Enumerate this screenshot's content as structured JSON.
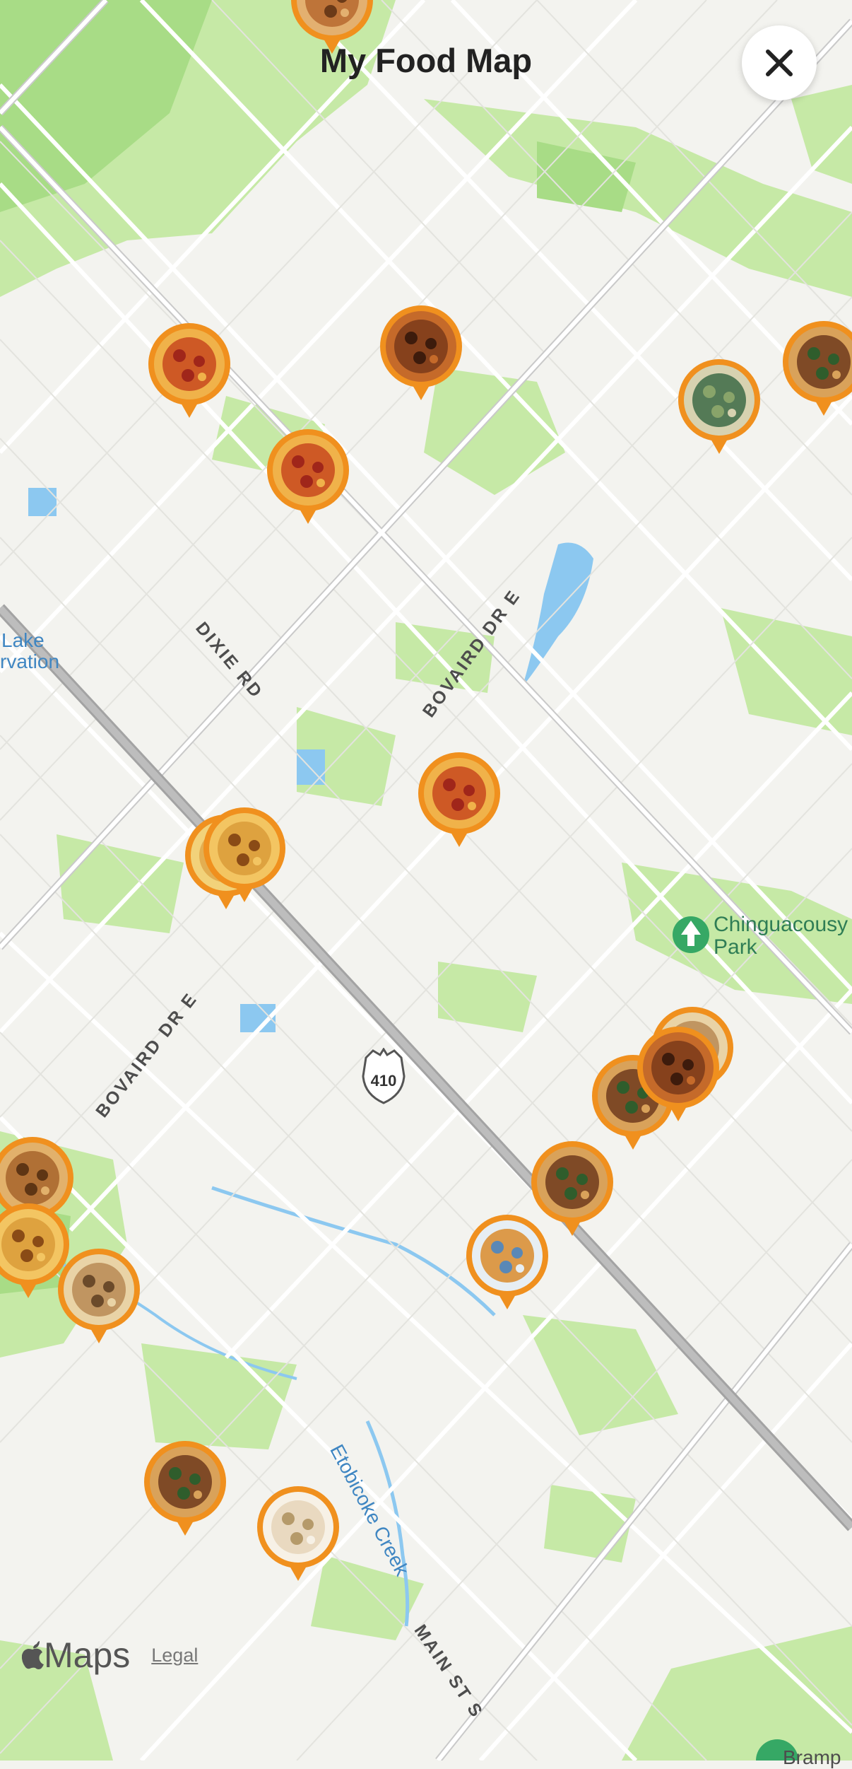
{
  "header": {
    "title": "My Food Map",
    "close_icon": "close-icon"
  },
  "map": {
    "road_labels": [
      "DIXIE RD",
      "BOVAIRD DR E",
      "BOVAIRD DR E",
      "MAIN ST S"
    ],
    "water_labels": [
      "Etobicoke Creek"
    ],
    "places": {
      "lake_fragment_1": "Lake",
      "lake_fragment_2": "rvation",
      "park": "Chinguacousy Park",
      "park_l1": "Chinguacousy",
      "park_l2": "Park",
      "bottom_fragment": "Bramp"
    },
    "highway_shield": "410",
    "colors": {
      "background": "#f3f3ef",
      "green": "#c6e9a6",
      "dark_green": "#a8dc86",
      "water": "#8cc8f0",
      "road": "#ffffff",
      "highway": "#a3a3a3",
      "pin_orange": "#f0901e"
    }
  },
  "food_pins": [
    {
      "food": "pizza"
    },
    {
      "food": "pizza"
    },
    {
      "food": "wings"
    },
    {
      "food": "salad"
    },
    {
      "food": "burger"
    },
    {
      "food": "pizza"
    },
    {
      "food": "nachos"
    },
    {
      "food": "fries"
    },
    {
      "food": "sandwich"
    },
    {
      "food": "burger"
    },
    {
      "food": "wings"
    },
    {
      "food": "burger"
    },
    {
      "food": "drink"
    },
    {
      "food": "fried-food"
    },
    {
      "food": "fries"
    },
    {
      "food": "sandwich"
    },
    {
      "food": "burger"
    },
    {
      "food": "dessert"
    },
    {
      "food": "food"
    }
  ],
  "attribution": {
    "maps_logo": "Maps",
    "legal": "Legal"
  }
}
